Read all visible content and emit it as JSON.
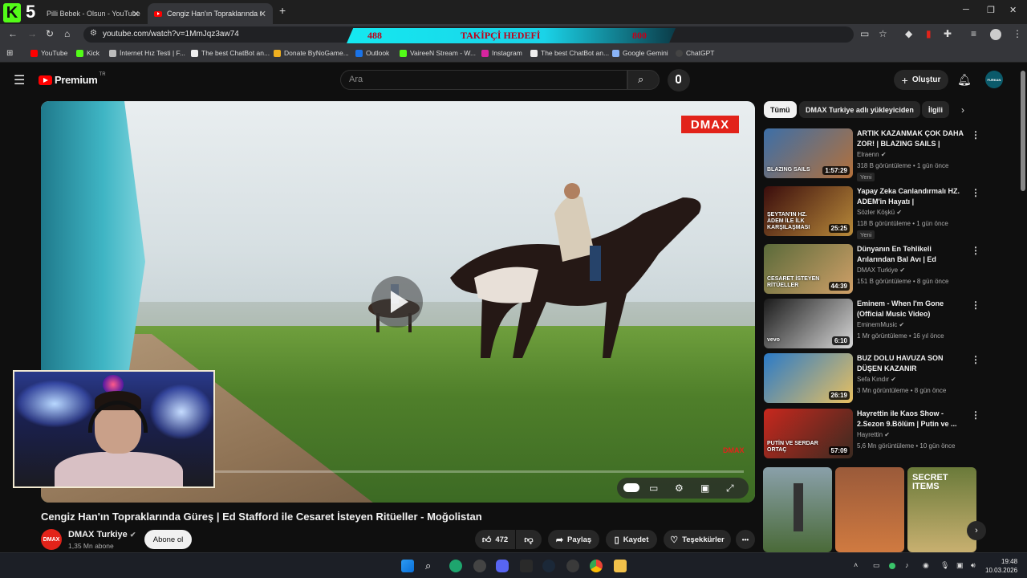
{
  "browser": {
    "tabs": [
      {
        "title": "Pilli Bebek - Olsun - YouTube",
        "active": false
      },
      {
        "title": "Cengiz Han'ın Topraklarında Gü",
        "active": true
      }
    ],
    "new_tab": "+",
    "url": "youtube.com/watch?v=1MmJqz3aw74",
    "bookmarks": [
      "YouTube",
      "Kick",
      "İnternet Hız Testi | F...",
      "The best ChatBot an...",
      "Donate ByNoGame...",
      "Outlook",
      "VaireeN Stream - W...",
      "Instagram",
      "The best ChatBot an...",
      "Google Gemini",
      "ChatGPT"
    ]
  },
  "overlay": {
    "kick_count": "5",
    "goal_current": "488",
    "goal_label": "TAKİPÇİ HEDEFİ",
    "goal_target": "800"
  },
  "youtube": {
    "logo": "Premium",
    "logo_sup": "TR",
    "search_placeholder": "Ara",
    "create_label": "Oluştur",
    "avatar_label": "FURKAN"
  },
  "video": {
    "title": "Cengiz Han'ın Topraklarında Güreş | Ed Stafford ile Cesaret İsteyen Ritüeller - Moğolistan",
    "watermark": "DMAX",
    "watermark_small": "DMAX",
    "channel": "DMAX Turkiye",
    "channel_avatar": "DMAX",
    "subscribers": "1,35 Mn abone",
    "subscribe_label": "Abone ol",
    "likes": "472",
    "share_label": "Paylaş",
    "save_label": "Kaydet",
    "thanks_label": "Teşekkürler",
    "more_label": "•••"
  },
  "chips": [
    "Tümü",
    "DMAX Turkiye adlı yükleyiciden",
    "İlgili"
  ],
  "recommendations": [
    {
      "title": "ARTIK KAZANMAK ÇOK DAHA ZOR! | BLAZING SAILS | BÖLÜ...",
      "channel": "Elraenn",
      "meta": "318 B görüntüleme • 1 gün önce",
      "badge": "Yeni",
      "duration": "1:57:29",
      "thumb_text": "BLAZING SAILS",
      "color1": "#3c6fa8",
      "color2": "#b4703a"
    },
    {
      "title": "Yapay Zeka Canlandırmalı HZ. ADEM'in Hayatı | Peygamberle...",
      "channel": "Sözler Köşkü",
      "meta": "118 B görüntüleme • 1 gün önce",
      "badge": "Yeni",
      "duration": "25:25",
      "thumb_text": "ŞEYTAN'IN HZ. ADEM İLE İLK KARŞILAŞMASI",
      "color1": "#3a0c0c",
      "color2": "#b88a3a"
    },
    {
      "title": "Dünyanın En Tehlikeli Arılarından Bal Avı | Ed Stafford...",
      "channel": "DMAX Turkiye",
      "meta": "151 B görüntüleme • 8 gün önce",
      "badge": "",
      "duration": "44:39",
      "thumb_text": "CESARET İSTEYEN RİTÜELLER",
      "color1": "#5a6a3a",
      "color2": "#d0a068"
    },
    {
      "title": "Eminem - When I'm Gone (Official Music Video)",
      "channel": "EminemMusic",
      "meta": "1 Mr görüntüleme • 16 yıl önce",
      "badge": "",
      "duration": "6:10",
      "thumb_text": "vevo",
      "color1": "#1a1a1a",
      "color2": "#d8d8d8"
    },
    {
      "title": "BUZ DOLU HAVUZA SON DÜŞEN KAZANIR",
      "channel": "Sefa Kındır",
      "meta": "3 Mn görüntüleme • 8 gün önce",
      "badge": "",
      "duration": "26:19",
      "thumb_text": "",
      "color1": "#2a7ac8",
      "color2": "#e8c060"
    },
    {
      "title": "Hayrettin ile Kaos Show - 2.Sezon 9.Bölüm | Putin ve ...",
      "channel": "Hayrettin",
      "meta": "5,6 Mn görüntüleme • 10 gün önce",
      "badge": "",
      "duration": "57:09",
      "thumb_text": "PUTİN VE SERDAR ORTAÇ",
      "color1": "#c8281e",
      "color2": "#3a2a20"
    }
  ],
  "shorts": [
    {
      "text": "",
      "color1": "#6a8a9a",
      "color2": "#4a6a38"
    },
    {
      "text": "",
      "color1": "#9a5a3a",
      "color2": "#d07a40"
    },
    {
      "text": "SECRET ITEMS",
      "color1": "#6a7a3a",
      "color2": "#c8b070"
    }
  ],
  "taskbar": {
    "time": "19:48",
    "date": "10.03.2026"
  },
  "colors": {
    "accent_red": "#ff0000",
    "dmax_red": "#e2231a",
    "banner_cyan": "#15e8f0"
  }
}
